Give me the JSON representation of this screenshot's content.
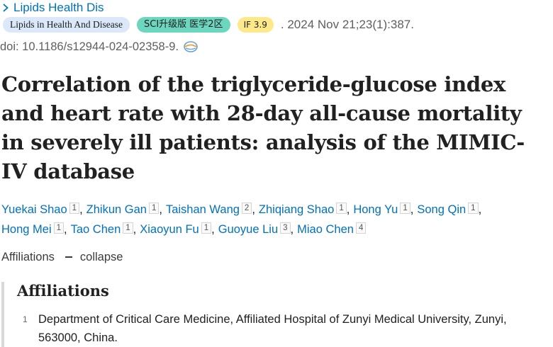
{
  "journal": {
    "link_label": "Lipids Health Dis"
  },
  "badges": {
    "journal_full": "Lipids in Health And Disease",
    "sci": "SCI升级版 医学2区",
    "impact_factor": "IF 3.9"
  },
  "citation": ". 2024 Nov 21;23(1):387.",
  "doi": "doi: 10.1186/s12944-024-02358-9.",
  "title": "Correlation of the triglyceride-glucose index and heart rate with 28-day all-cause mortality in severely ill patients: analysis of the MIMIC-IV database",
  "authors": [
    {
      "name": "Yuekai Shao",
      "aff": "1"
    },
    {
      "name": "Zhikun Gan",
      "aff": "1"
    },
    {
      "name": "Taishan Wang",
      "aff": "2"
    },
    {
      "name": "Zhiqiang Shao",
      "aff": "1"
    },
    {
      "name": "Hong Yu",
      "aff": "1"
    },
    {
      "name": "Song Qin",
      "aff": "1"
    },
    {
      "name": "Hong Mei",
      "aff": "1"
    },
    {
      "name": "Tao Chen",
      "aff": "1"
    },
    {
      "name": "Xiaoyun Fu",
      "aff": "1"
    },
    {
      "name": "Guoyue Liu",
      "aff": "3"
    },
    {
      "name": "Miao Chen",
      "aff": "4"
    }
  ],
  "affiliations_toggle": {
    "label": "Affiliations",
    "action": "collapse"
  },
  "affiliations": {
    "heading": "Affiliations",
    "items": [
      {
        "index": "1",
        "text": "Department of Critical Care Medicine, Affiliated Hospital of Zunyi Medical University, Zunyi, 563000, China."
      }
    ]
  }
}
